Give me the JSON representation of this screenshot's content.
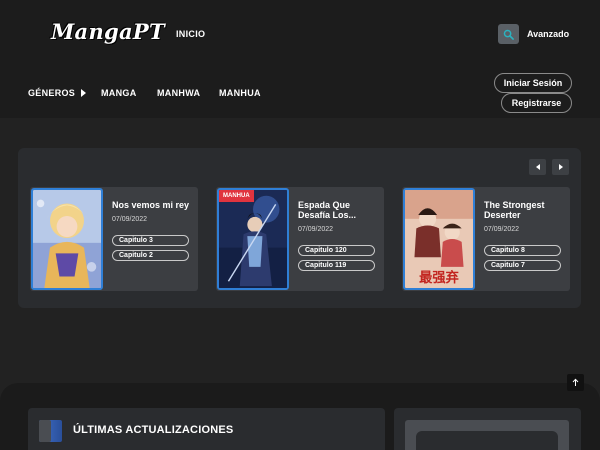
{
  "header": {
    "logo": "MangaPT",
    "inicio": "INICIO",
    "avanzado": "Avanzado",
    "search_icon": "search-icon"
  },
  "nav": {
    "generos": "GÉNEROS",
    "manga": "MANGA",
    "manhwa": "MANHWA",
    "manhua": "MANHUA",
    "login": "Iniciar Sesión",
    "register": "Registrarse"
  },
  "slider": {
    "cards": [
      {
        "title": "Nos vemos mi rey",
        "date": "07/09/2022",
        "badge": "",
        "chapters": [
          "Capitulo 3",
          "Capitulo 2"
        ]
      },
      {
        "title": "Espada Que Desafía Los...",
        "date": "07/09/2022",
        "badge": "MANHUA",
        "chapters": [
          "Capitulo 120",
          "Capitulo 119"
        ]
      },
      {
        "title": "The Strongest Deserter",
        "date": "07/09/2022",
        "badge": "",
        "chapters": [
          "Capitulo 8",
          "Capitulo 7"
        ]
      }
    ]
  },
  "latest": {
    "title": "ÚLTIMAS ACTUALIZACIONES"
  },
  "colors": {
    "accent_blue": "#2f7fd6",
    "badge_red": "#e0343f",
    "search_teal": "#2bb3c0"
  }
}
